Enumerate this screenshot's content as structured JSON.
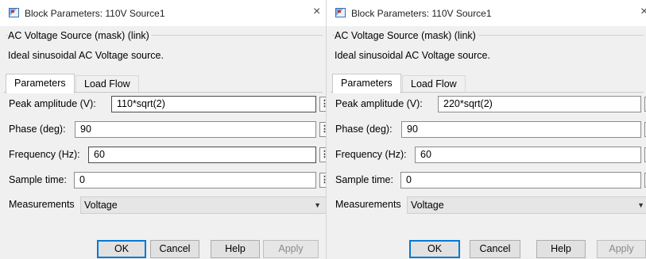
{
  "dialogs": [
    {
      "title": "Block Parameters: 110V Source1",
      "close_glyph": "×",
      "mask_title": "AC Voltage Source (mask) (link)",
      "description": "Ideal sinusoidal AC Voltage source.",
      "tabs": [
        "Parameters",
        "Load Flow"
      ],
      "params": {
        "peak_amplitude": {
          "label": "Peak amplitude (V):",
          "value": "110*sqrt(2)"
        },
        "phase": {
          "label": "Phase (deg):",
          "value": "90"
        },
        "frequency": {
          "label": "Frequency (Hz):",
          "value": "60"
        },
        "sample_time": {
          "label": "Sample time:",
          "value": "0"
        },
        "measurements": {
          "label": "Measurements",
          "value": "Voltage"
        }
      },
      "buttons": {
        "ok": "OK",
        "cancel": "Cancel",
        "help": "Help",
        "apply": "Apply"
      }
    },
    {
      "title": "Block Parameters: 110V Source1",
      "close_glyph": "×",
      "mask_title": "AC Voltage Source (mask) (link)",
      "description": "Ideal sinusoidal AC Voltage source.",
      "tabs": [
        "Parameters",
        "Load Flow"
      ],
      "params": {
        "peak_amplitude": {
          "label": "Peak amplitude (V):",
          "value": "220*sqrt(2)"
        },
        "phase": {
          "label": "Phase (deg):",
          "value": "90"
        },
        "frequency": {
          "label": "Frequency (Hz):",
          "value": "60"
        },
        "sample_time": {
          "label": "Sample time:",
          "value": "0"
        },
        "measurements": {
          "label": "Measurements",
          "value": "Voltage"
        }
      },
      "buttons": {
        "ok": "OK",
        "cancel": "Cancel",
        "help": "Help",
        "apply": "Apply"
      }
    }
  ],
  "icons": {
    "app": "simulink-block-icon",
    "param_dots": "vertical-ellipsis-icon",
    "dropdown": "chevron-down-icon",
    "close": "close-icon"
  },
  "colors": {
    "dialog_bg": "#f0f0f0",
    "titlebar_bg": "#ffffff",
    "focus_border": "#0078d7",
    "disabled_text": "#8a8a8a"
  }
}
